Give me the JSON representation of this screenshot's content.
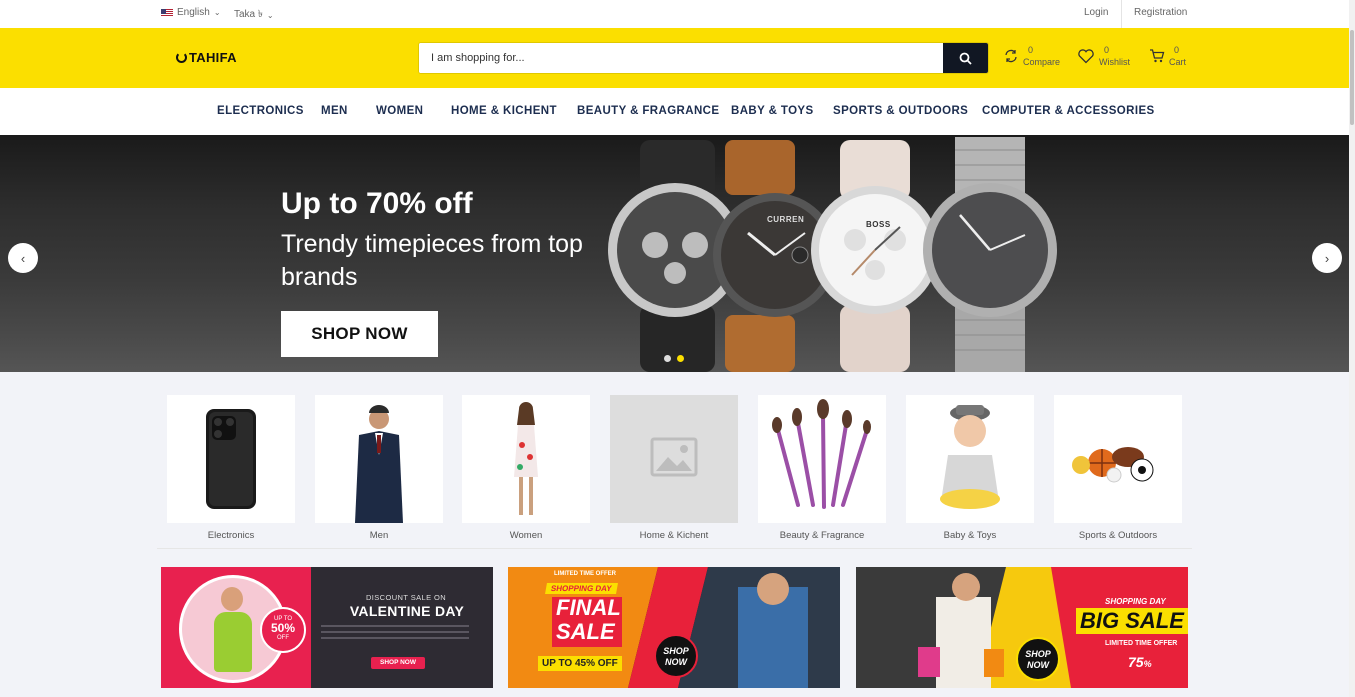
{
  "topbar": {
    "language": "English",
    "currency": "Taka ৳",
    "login": "Login",
    "registration": "Registration"
  },
  "header": {
    "logo": "TAHIFA",
    "search_placeholder": "I am shopping for...",
    "compare": {
      "count": "0",
      "label": "Compare"
    },
    "wishlist": {
      "count": "0",
      "label": "Wishlist"
    },
    "cart": {
      "count": "0",
      "label": "Cart"
    }
  },
  "nav": {
    "items": [
      "ELECTRONICS",
      "MEN",
      "WOMEN",
      "HOME & KICHENT",
      "BEAUTY & FRAGRANCE",
      "BABY & TOYS",
      "SPORTS & OUTDOORS",
      "COMPUTER & ACCESSORIES"
    ]
  },
  "hero": {
    "title": "Up to 70% off",
    "subtitle": "Trendy timepieces from top brands",
    "cta": "SHOP NOW",
    "watch_brands": [
      "CURREN",
      "BOSS"
    ],
    "slide_count": 2,
    "active_slide": 2
  },
  "categories": [
    "Electronics",
    "Men",
    "Women",
    "Home & Kichent",
    "Beauty & Fragrance",
    "Baby & Toys",
    "Sports & Outdoors"
  ],
  "banners": {
    "b1": {
      "top": "DISCOUNT SALE ON",
      "title": "VALENTINE DAY",
      "badge_top": "UP TO",
      "badge_value": "50%",
      "badge_bottom": "OFF",
      "cta": "SHOP NOW"
    },
    "b2": {
      "top": "LIMITED TIME OFFER",
      "tag": "SHOPPING DAY",
      "title1": "FINAL",
      "title2": "SALE",
      "discount": "UP TO 45% OFF",
      "cta1": "SHOP",
      "cta2": "NOW"
    },
    "b3": {
      "tag": "SHOPPING DAY",
      "title": "BIG SALE",
      "sub": "LIMITED TIME OFFER",
      "cta1": "SHOP",
      "cta2": "NOW",
      "pct": "75",
      "pct_unit": "%"
    }
  },
  "colors": {
    "brand_yellow": "#fbdf00",
    "nav_text": "#1c2d4f",
    "search_button": "#111723",
    "accent_red": "#e8213a"
  }
}
